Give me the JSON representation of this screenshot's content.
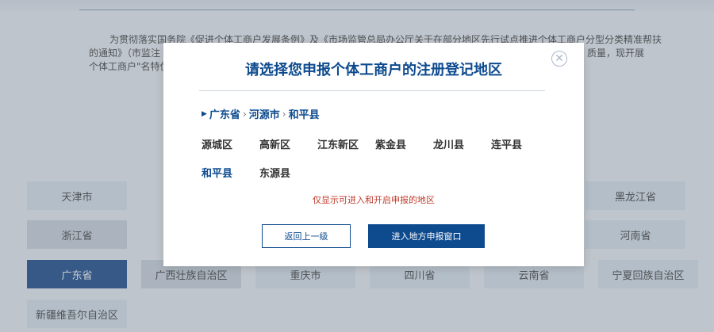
{
  "background": {
    "intro_line1": "为贯彻落实国务院《促进个体工商户发展条例》及《市场监管总局办公厅关于在部分地区先行试点推进个体工商户分型分类精准帮扶",
    "intro_line2": "的通知》（市监注",
    "intro_line2b": "质量，现开展",
    "intro_line3": "个体工商户\"名特优",
    "provinces": [
      {
        "label": "天津市",
        "state": "light"
      },
      {
        "label": "黑龙江省",
        "state": "light"
      },
      {
        "label": "浙江省",
        "state": "mid"
      },
      {
        "label": "河南省",
        "state": "light"
      },
      {
        "label": "广东省",
        "state": "active"
      },
      {
        "label": "广西壮族自治区",
        "state": "mid"
      },
      {
        "label": "重庆市",
        "state": "light"
      },
      {
        "label": "四川省",
        "state": "light"
      },
      {
        "label": "云南省",
        "state": "light"
      },
      {
        "label": "宁夏回族自治区",
        "state": "light"
      },
      {
        "label": "新疆维吾尔自治区",
        "state": "light"
      }
    ]
  },
  "modal": {
    "title": "请选择您申报个体工商户的注册登记地区",
    "close_label": "✕",
    "breadcrumb": [
      "广东省",
      "河源市",
      "和平县"
    ],
    "breadcrumb_sep": "›",
    "districts": [
      "源城区",
      "高新区",
      "江东新区",
      "紫金县",
      "龙川县",
      "连平县",
      "和平县",
      "东源县"
    ],
    "selected_district": "和平县",
    "note": "仅显示可进入和开启申报的地区",
    "back_button": "返回上一级",
    "enter_button": "进入地方申报窗口"
  }
}
